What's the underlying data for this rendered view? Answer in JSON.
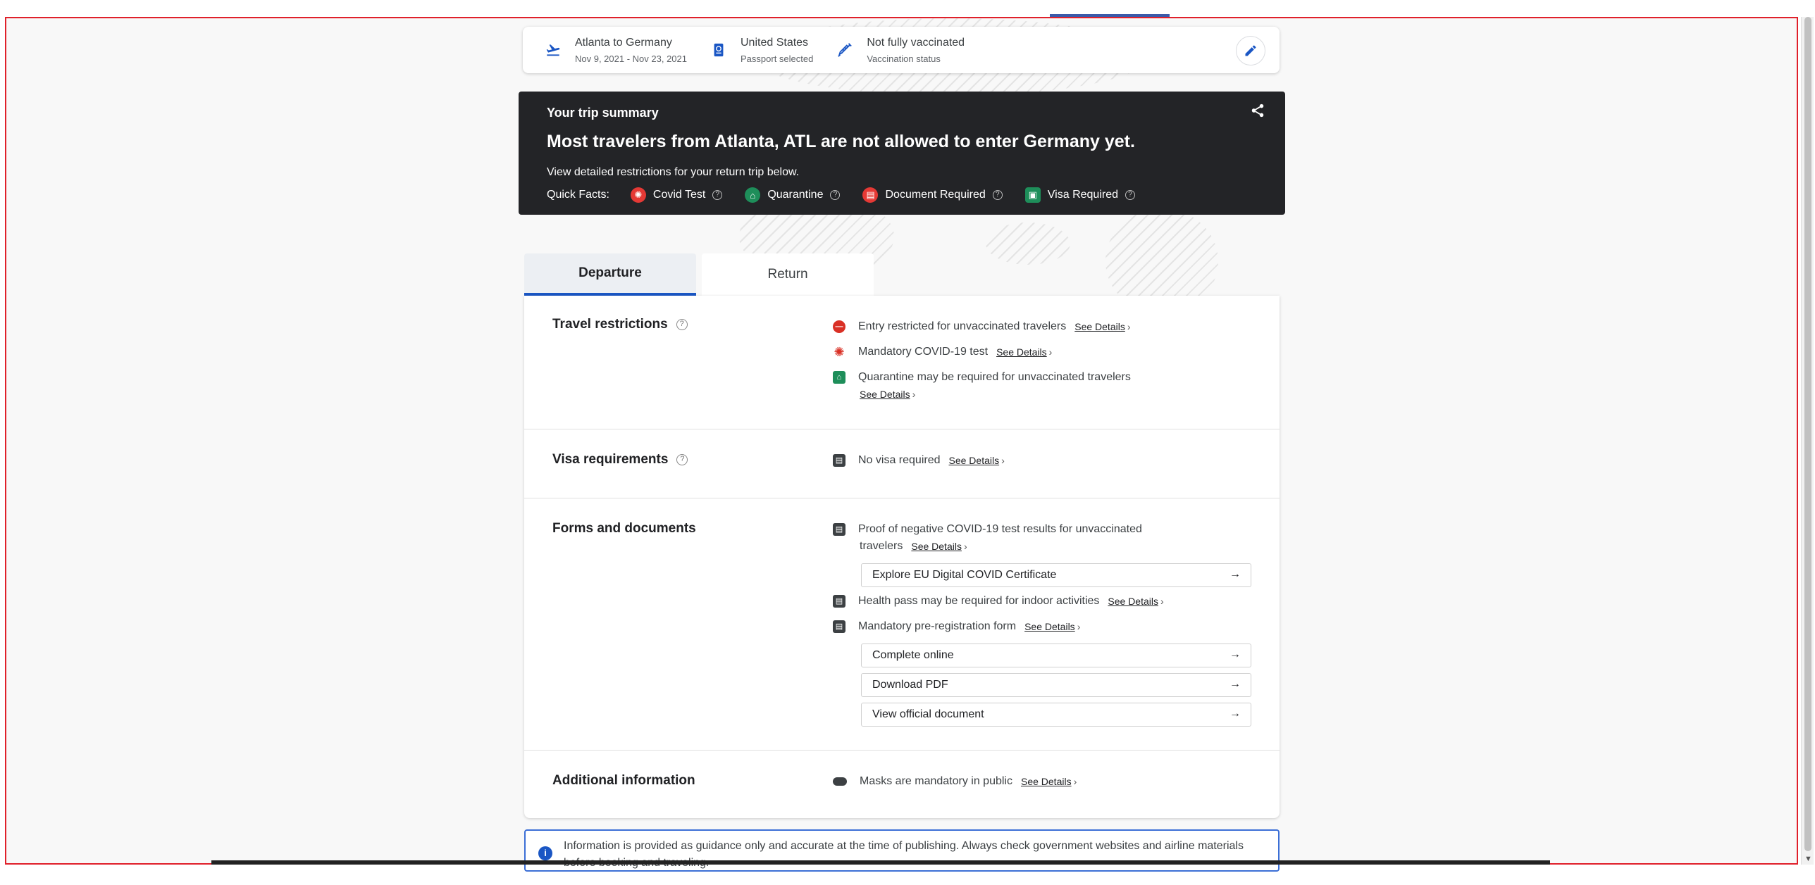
{
  "trip_bar": {
    "route": "Atlanta to Germany",
    "dates": "Nov 9, 2021 - Nov 23, 2021",
    "country": "United States",
    "passport": "Passport selected",
    "vaccination": "Not fully vaccinated",
    "vaccination_label": "Vaccination status"
  },
  "summary": {
    "label": "Your trip summary",
    "headline": "Most travelers from Atlanta, ATL are not allowed to enter Germany yet.",
    "sub": "View detailed restrictions for your return trip below.",
    "quick_facts_label": "Quick Facts:",
    "facts": [
      {
        "label": "Covid Test",
        "icon": "virus-icon",
        "color": "#e53935"
      },
      {
        "label": "Quarantine",
        "icon": "house-icon",
        "color": "#1e8e5a"
      },
      {
        "label": "Document Required",
        "icon": "document-icon",
        "color": "#e53935"
      },
      {
        "label": "Visa Required",
        "icon": "passport-icon",
        "color": "#1e8e5a"
      }
    ]
  },
  "tabs": [
    "Departure",
    "Return"
  ],
  "sections": {
    "travel": {
      "title": "Travel restrictions",
      "items": [
        "Entry restricted for unvaccinated travelers",
        "Mandatory COVID-19 test",
        "Quarantine may be required for unvaccinated travelers"
      ]
    },
    "visa": {
      "title": "Visa requirements",
      "items": [
        "No visa required"
      ]
    },
    "forms": {
      "title": "Forms and documents",
      "items": [
        "Proof of negative COVID-19 test results for unvaccinated",
        "travelers",
        "Health pass may be required for indoor activities",
        "Mandatory pre-registration form"
      ],
      "buttons": [
        "Explore EU Digital COVID Certificate",
        "Complete online",
        "Download PDF",
        "View official document"
      ]
    },
    "additional": {
      "title": "Additional information",
      "items": [
        "Masks are mandatory in public"
      ]
    }
  },
  "see_details": "See Details",
  "info_note": "Information is provided as guidance only and accurate at the time of publishing. Always check government websites and airline materials before booking and traveling."
}
